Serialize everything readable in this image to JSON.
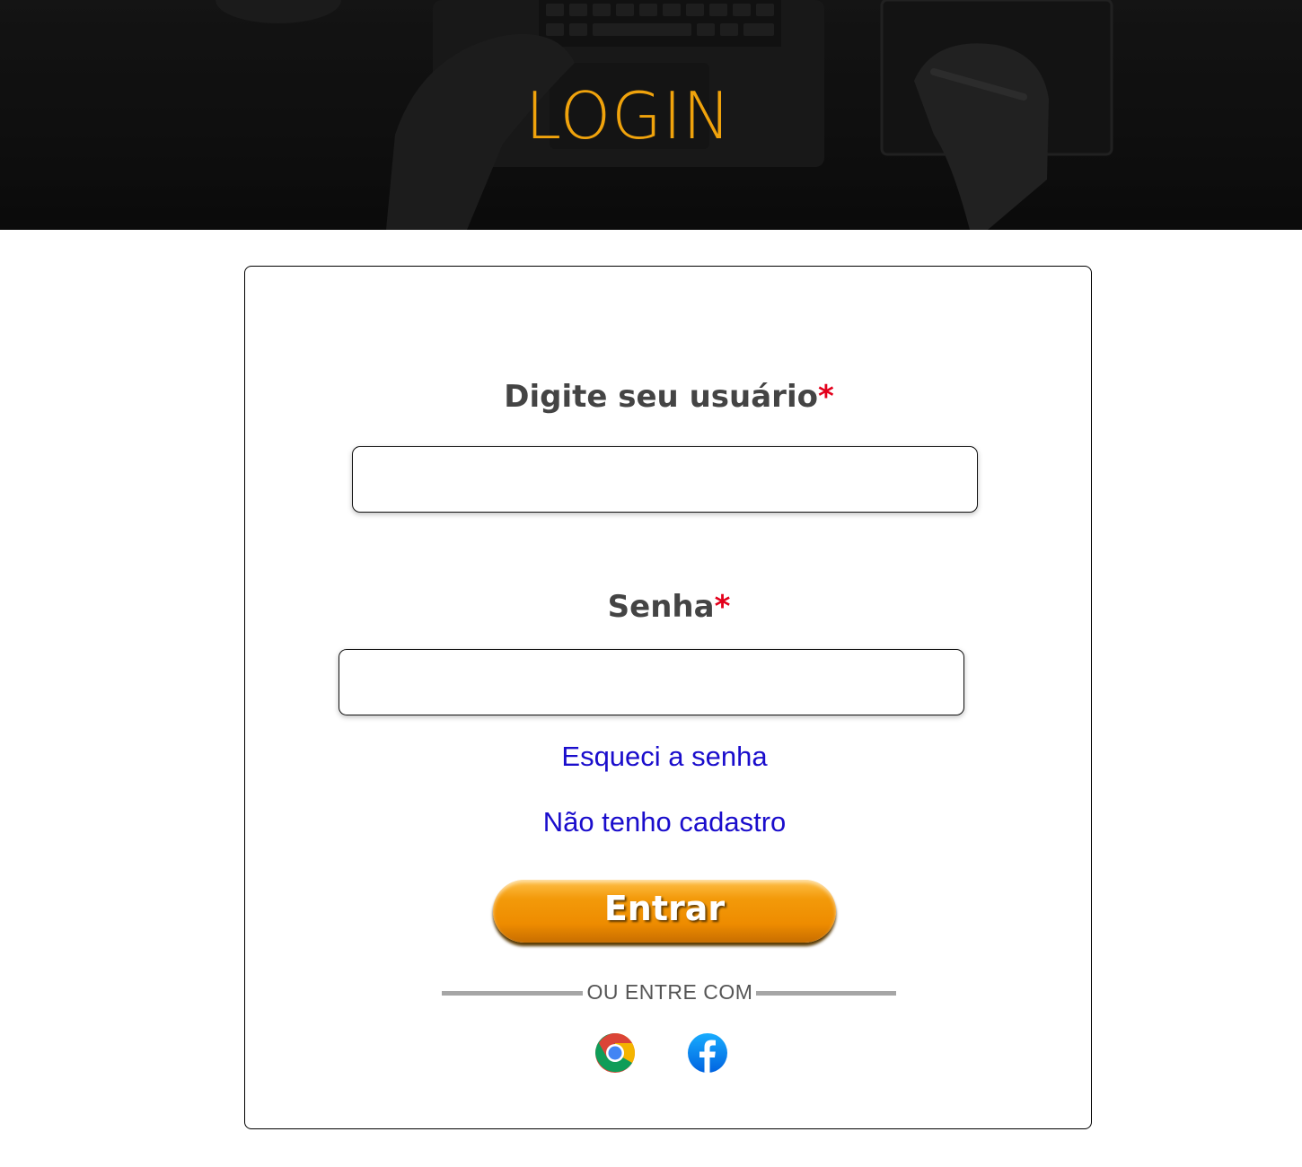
{
  "header": {
    "title": "LOGIN"
  },
  "form": {
    "username": {
      "label": "Digite seu usuário",
      "required_mark": "*",
      "value": ""
    },
    "password": {
      "label": "Senha",
      "required_mark": "*",
      "value": ""
    },
    "forgot_password_link": "Esqueci a senha",
    "register_link": "Não tenho cadastro",
    "submit_label": "Entrar",
    "alt_login_text": "OU ENTRE COM",
    "social_logins": [
      {
        "name": "google",
        "icon": "chrome-icon"
      },
      {
        "name": "facebook",
        "icon": "facebook-icon"
      }
    ]
  },
  "colors": {
    "accent": "#f0a30c",
    "button": "#ee8c00",
    "link": "#1a0dcc",
    "required": "#e3001b",
    "label": "#444444",
    "header_bg": "#151515"
  }
}
